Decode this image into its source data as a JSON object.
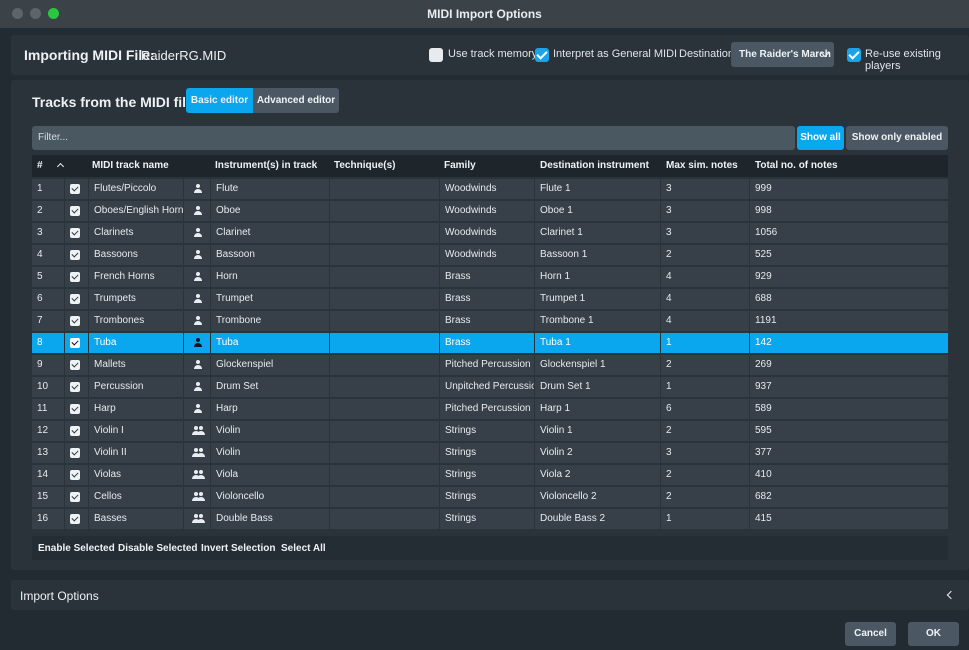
{
  "window": {
    "title": "MIDI Import Options"
  },
  "file": {
    "label": "Importing MIDI File:",
    "name": "RaiderRG.MID"
  },
  "options": {
    "use_track_memory": {
      "label": "Use track memory",
      "checked": false
    },
    "interpret_general_midi": {
      "label": "Interpret as General MIDI",
      "checked": true
    },
    "destination_label": "Destination:",
    "destination_value": "The Raider's March",
    "reuse_players": {
      "label": "Re-use existing players",
      "checked": true
    }
  },
  "tracks_section": {
    "title": "Tracks from the MIDI file",
    "tabs": [
      "Basic editor",
      "Advanced editor"
    ],
    "active_tab": "Basic editor",
    "filter_placeholder": "Filter...",
    "show_all": "Show all",
    "show_only_enabled": "Show only enabled"
  },
  "table": {
    "headers": {
      "num": "#",
      "name": "MIDI track name",
      "instrument": "Instrument(s) in track",
      "technique": "Technique(s)",
      "family": "Family",
      "destination": "Destination instrument",
      "max": "Max sim. notes",
      "total": "Total no. of notes"
    },
    "rows": [
      {
        "num": "1",
        "name": "Flutes/Piccolo",
        "icon": "single-player-icon",
        "instrument": "Flute",
        "technique": "",
        "family": "Woodwinds",
        "destination": "Flute 1",
        "max": "3",
        "total": "999",
        "enabled": true
      },
      {
        "num": "2",
        "name": "Oboes/English Horn",
        "icon": "single-player-icon",
        "instrument": "Oboe",
        "technique": "",
        "family": "Woodwinds",
        "destination": "Oboe 1",
        "max": "3",
        "total": "998",
        "enabled": true
      },
      {
        "num": "3",
        "name": "Clarinets",
        "icon": "single-player-icon",
        "instrument": "Clarinet",
        "technique": "",
        "family": "Woodwinds",
        "destination": "Clarinet 1",
        "max": "3",
        "total": "1056",
        "enabled": true
      },
      {
        "num": "4",
        "name": "Bassoons",
        "icon": "single-player-icon",
        "instrument": "Bassoon",
        "technique": "",
        "family": "Woodwinds",
        "destination": "Bassoon 1",
        "max": "2",
        "total": "525",
        "enabled": true
      },
      {
        "num": "5",
        "name": "French Horns",
        "icon": "single-player-icon",
        "instrument": "Horn",
        "technique": "",
        "family": "Brass",
        "destination": "Horn 1",
        "max": "4",
        "total": "929",
        "enabled": true
      },
      {
        "num": "6",
        "name": "Trumpets",
        "icon": "single-player-icon",
        "instrument": "Trumpet",
        "technique": "",
        "family": "Brass",
        "destination": "Trumpet 1",
        "max": "4",
        "total": "688",
        "enabled": true
      },
      {
        "num": "7",
        "name": "Trombones",
        "icon": "single-player-icon",
        "instrument": "Trombone",
        "technique": "",
        "family": "Brass",
        "destination": "Trombone 1",
        "max": "4",
        "total": "1191",
        "enabled": true
      },
      {
        "num": "8",
        "name": "Tuba",
        "icon": "single-player-icon",
        "instrument": "Tuba",
        "technique": "",
        "family": "Brass",
        "destination": "Tuba 1",
        "max": "1",
        "total": "142",
        "enabled": true,
        "selected": true
      },
      {
        "num": "9",
        "name": "Mallets",
        "icon": "single-player-icon",
        "instrument": "Glockenspiel",
        "technique": "",
        "family": "Pitched Percussion",
        "destination": "Glockenspiel 1",
        "max": "2",
        "total": "269",
        "enabled": true
      },
      {
        "num": "10",
        "name": "Percussion",
        "icon": "single-player-icon",
        "instrument": "Drum Set",
        "technique": "",
        "family": "Unpitched Percussion",
        "destination": "Drum Set 1",
        "max": "1",
        "total": "937",
        "enabled": true
      },
      {
        "num": "11",
        "name": "Harp",
        "icon": "single-player-icon",
        "instrument": "Harp",
        "technique": "",
        "family": "Pitched Percussion",
        "destination": "Harp 1",
        "max": "6",
        "total": "589",
        "enabled": true
      },
      {
        "num": "12",
        "name": "Violin I",
        "icon": "section-player-icon",
        "instrument": "Violin",
        "technique": "",
        "family": "Strings",
        "destination": "Violin 1",
        "max": "2",
        "total": "595",
        "enabled": true
      },
      {
        "num": "13",
        "name": "Violin II",
        "icon": "section-player-icon",
        "instrument": "Violin",
        "technique": "",
        "family": "Strings",
        "destination": "Violin 2",
        "max": "3",
        "total": "377",
        "enabled": true
      },
      {
        "num": "14",
        "name": "Violas",
        "icon": "section-player-icon",
        "instrument": "Viola",
        "technique": "",
        "family": "Strings",
        "destination": "Viola 2",
        "max": "2",
        "total": "410",
        "enabled": true
      },
      {
        "num": "15",
        "name": "Cellos",
        "icon": "section-player-icon",
        "instrument": "Violoncello",
        "technique": "",
        "family": "Strings",
        "destination": "Violoncello 2",
        "max": "2",
        "total": "682",
        "enabled": true
      },
      {
        "num": "16",
        "name": "Basses",
        "icon": "section-player-icon",
        "instrument": "Double Bass",
        "technique": "",
        "family": "Strings",
        "destination": "Double Bass 2",
        "max": "1",
        "total": "415",
        "enabled": true
      }
    ]
  },
  "selection_actions": [
    "Enable Selected",
    "Disable Selected",
    "Invert Selection",
    "Select All"
  ],
  "import_options": {
    "label": "Import Options"
  },
  "footer": {
    "cancel": "Cancel",
    "ok": "OK"
  },
  "colors": {
    "accent": "#0aa6ee",
    "background": "#232b32",
    "panel": "#2b333a",
    "cell": "#374048"
  }
}
